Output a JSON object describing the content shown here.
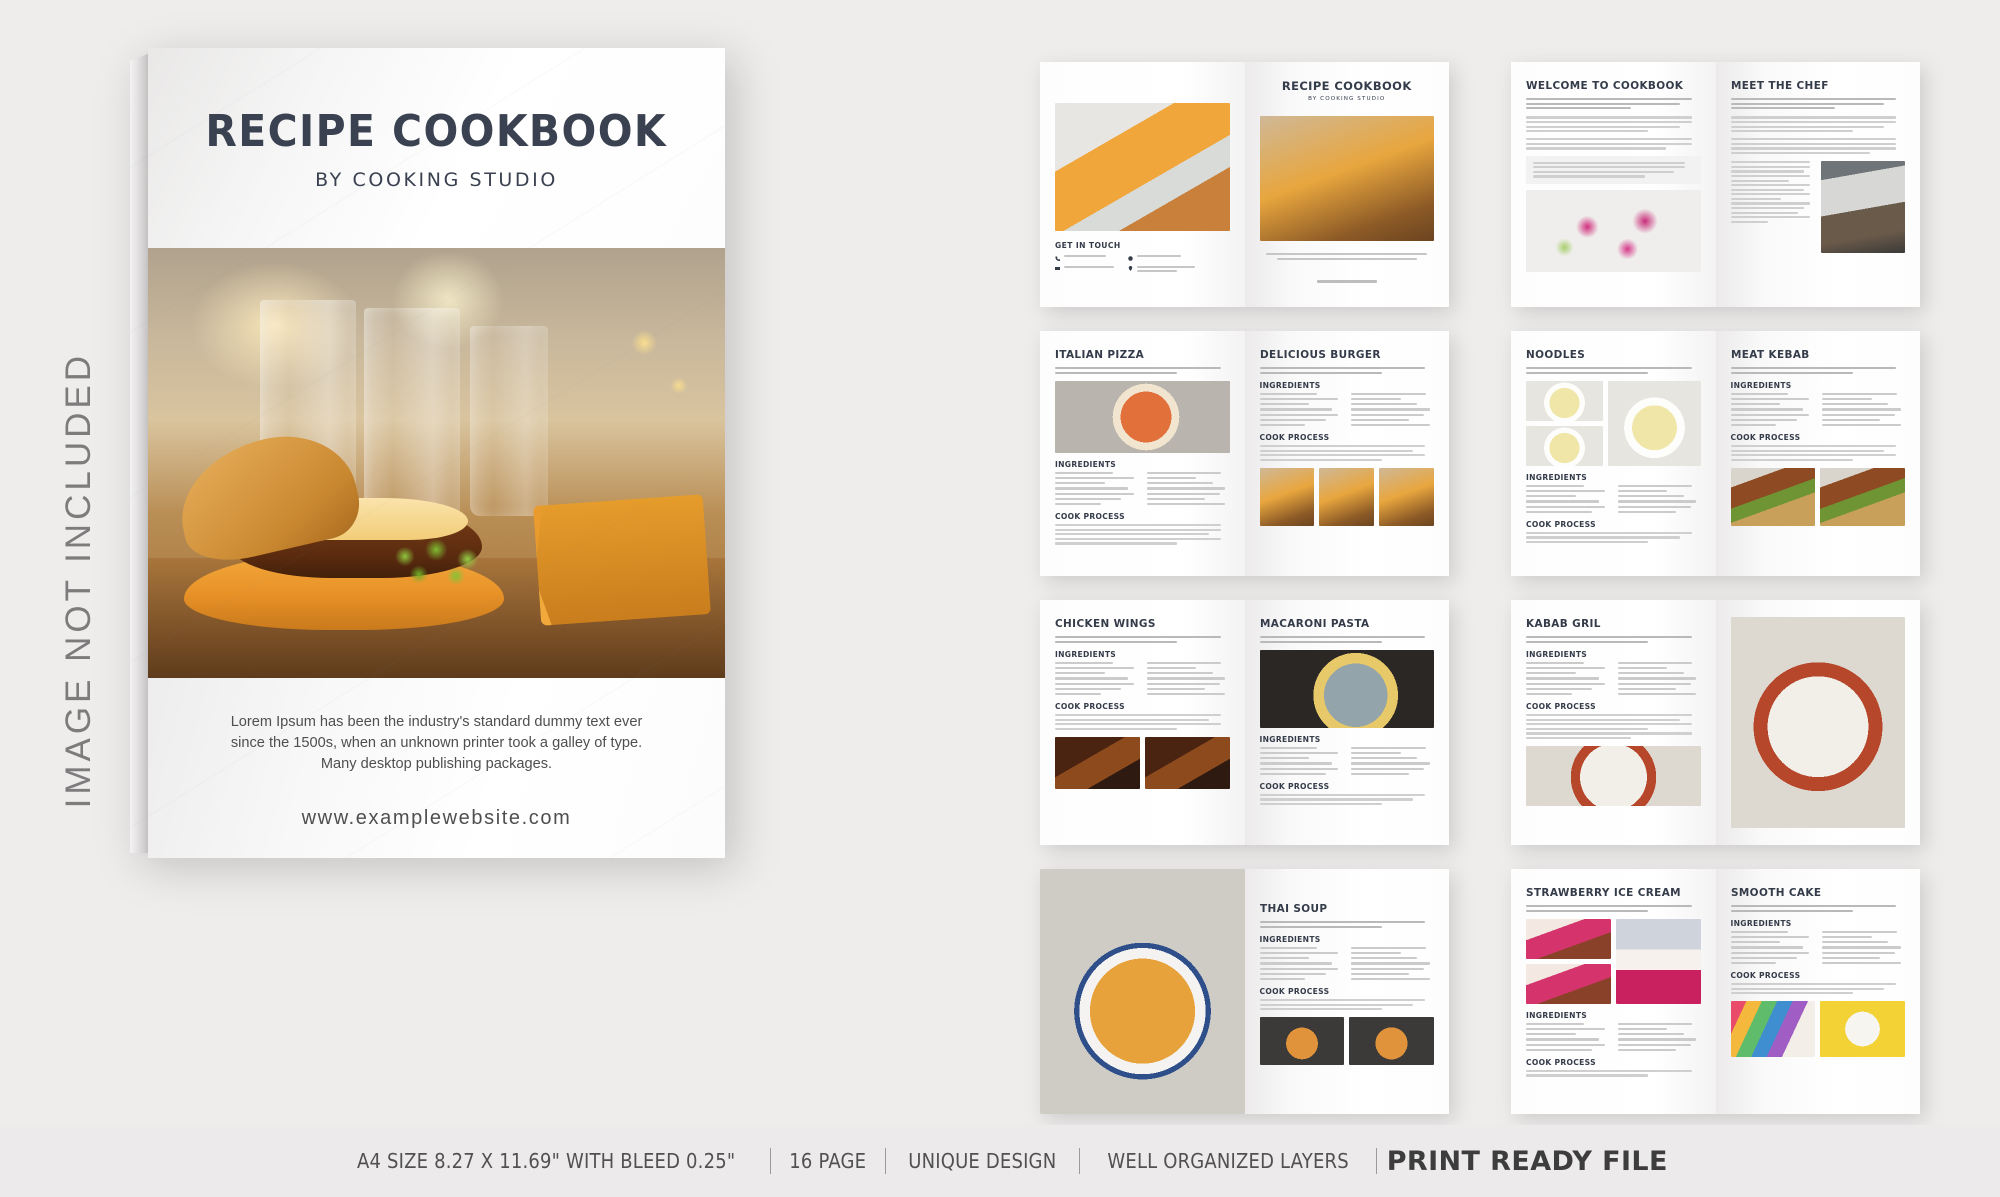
{
  "side_note": "IMAGE NOT INCLUDED",
  "cover": {
    "title": "RECIPE COOKBOOK",
    "subtitle": "BY COOKING STUDIO",
    "blurb": "Lorem Ipsum has been the industry's standard dummy text ever since the 1500s, when an unknown printer took a galley of type. Many desktop publishing packages.",
    "website": "www.examplewebsite.com"
  },
  "footer": {
    "size": "A4 SIZE 8.27 X 11.69\" WITH BLEED 0.25\"",
    "pages": "16 PAGE",
    "design": "UNIQUE DESIGN",
    "layers": "WELL ORGANIZED LAYERS",
    "print": "PRINT READY FILE"
  },
  "labels": {
    "ingredients": "INGREDIENTS",
    "cook_process": "COOK PROCESS",
    "get_in_touch": "GET IN TOUCH"
  },
  "spreads": [
    {
      "id": "cover-spread",
      "left_title": "",
      "right_title": "RECIPE COOKBOOK",
      "right_subtitle": "BY COOKING STUDIO"
    },
    {
      "id": "intro-spread",
      "left_title": "WELCOME TO COOKBOOK",
      "right_title": "MEET THE CHEF"
    },
    {
      "id": "pizza-burger-spread",
      "left_title": "ITALIAN PIZZA",
      "right_title": "DELICIOUS BURGER"
    },
    {
      "id": "noodles-kebab-spread",
      "left_title": "NOODLES",
      "right_title": "MEAT KEBAB"
    },
    {
      "id": "wings-pasta-spread",
      "left_title": "CHICKEN WINGS",
      "right_title": "MACARONI PASTA"
    },
    {
      "id": "kabab-spread",
      "left_title": "KABAB GRIL",
      "right_title": ""
    },
    {
      "id": "thai-soup-spread",
      "left_title": "",
      "right_title": "THAI SOUP"
    },
    {
      "id": "dessert-spread",
      "left_title": "STRAWBERRY ICE CREAM",
      "right_title": "SMOOTH CAKE"
    }
  ],
  "colors": {
    "background": "#efedec",
    "heading": "#343b49",
    "footer_bar": "#eceaea",
    "body_text": "#4f4f4f"
  }
}
